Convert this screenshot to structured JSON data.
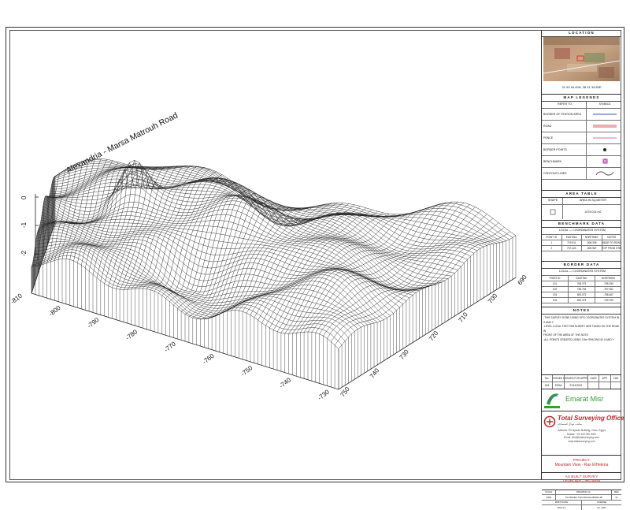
{
  "drawing": {
    "road_label": "Alexandria - Marsa Matrouh Road",
    "z_ticks": [
      "0",
      "-1",
      "-2"
    ],
    "x_ticks": [
      "-810",
      "-800",
      "-790",
      "-780",
      "-770",
      "-760",
      "-750",
      "-740",
      "-730"
    ],
    "y_ticks": [
      "750",
      "740",
      "730",
      "720",
      "710",
      "700",
      "690"
    ]
  },
  "title_block": {
    "location_header": "LOCATION",
    "coordinates": "31 03 54.40N, 28 01 34.80E",
    "legend_header": "MAP LEGENDS",
    "legend_col_refer": "REFER TO",
    "legend_col_symbol": "SYMBOL",
    "legend_items": [
      {
        "label": "BORDER OF STATION AREA",
        "symbol": "line-blue"
      },
      {
        "label": "ROAD",
        "symbol": "line-red"
      },
      {
        "label": "FENCE",
        "symbol": "line-pink"
      },
      {
        "label": "BORDER POINTS",
        "symbol": "dot"
      },
      {
        "label": "BENCHMARK",
        "symbol": "benchmark"
      },
      {
        "label": "CONTOUR LINES",
        "symbol": "contour"
      }
    ],
    "area_header": "AREA TABLE",
    "area_col_shape": "SHAPE",
    "area_col_area": "AREA IN SQ.METER",
    "area_value": "2078.014 m2",
    "benchmark_header": "BENCHMARK DATA",
    "benchmark_system": "LOCAL — COORDINATES SYSTEM",
    "benchmark_cols": [
      "POINT ID",
      "EASTING",
      "NORTHING",
      "NOTES"
    ],
    "benchmark_rows": [
      [
        "1",
        "719.911",
        "-806.306",
        "NEAR TO ROAD"
      ],
      [
        "2",
        "737.424",
        "-800.987",
        "TOP FROM STEPS"
      ]
    ],
    "border_header": "BORDER DATA",
    "border_system": "LOCAL — COORDINATES SYSTEM",
    "border_cols": [
      "POINT ID",
      "EASTING",
      "NORTHING"
    ],
    "border_rows": [
      [
        "101",
        "708.273",
        "-795.330"
      ],
      [
        "102",
        "738.794",
        "-797.091"
      ],
      [
        "103",
        "693.073",
        "-758.467"
      ],
      [
        "104",
        "693.473",
        "-749.763"
      ]
    ],
    "notes_header": "NOTES",
    "notes_lines": [
      "-THIS SURVEY DONE USING GPS COORDINATES SYSTEM IN X AND Y",
      "-LEVEL LOCAL FOR THIS SURVEY ARE TAKEN ON THE ROAD IN",
      " FRONT OF THE AREA OF THE NOTE",
      "-ALL POINTS CREATED USING 2.5m SPACING IN X AND Y"
    ],
    "rev_cols": [
      "No.",
      "ISSUED BY",
      "ISSUED FOR APPROVAL",
      "DATE",
      "APP.",
      "CHK."
    ],
    "rev_row": [
      "A01",
      "ESSA",
      "21/12/2021",
      "",
      "",
      ""
    ],
    "client_name": "Emarat Misr",
    "client_tag": "Emarat Misr",
    "company_name": "Total Surveying Office",
    "company_arabic": "مكتب توتال للمساحة",
    "company_lines": [
      "Address: El Fayoum Building, Cairo, Egypt",
      "Mobile: +20 100 000 0000",
      "Email: info@totalsurveying.com",
      "www.totalsurveying.com"
    ],
    "project_label": "PROJECT",
    "project_name": "Mountain View - Ras ElHekma",
    "survey_line1": "AS BUILT SURVEY",
    "survey_line2": "LEVELING - 3D VIEW",
    "footer_scale_label": "SCALE",
    "footer_scale": "1/500",
    "footer_drawing_label": "DRAWING No.",
    "footer_drawing": "TS-PROJECT-MV-RAS-ELHEKMA-3D",
    "footer_rev_label": "REV.",
    "footer_rev": "01",
    "footer_print_label": "PRINT DATE",
    "footer_print": "2021-12",
    "footer_license_label": "LICENSE",
    "footer_license": "No. 2021"
  },
  "colors": {
    "line": "#222222",
    "road": "#c0282c",
    "fence": "#d46fb0",
    "border": "#3b53a6",
    "benchmark": "#c238b4",
    "company_red": "#c0282c",
    "client_green": "#3a9a3a"
  }
}
